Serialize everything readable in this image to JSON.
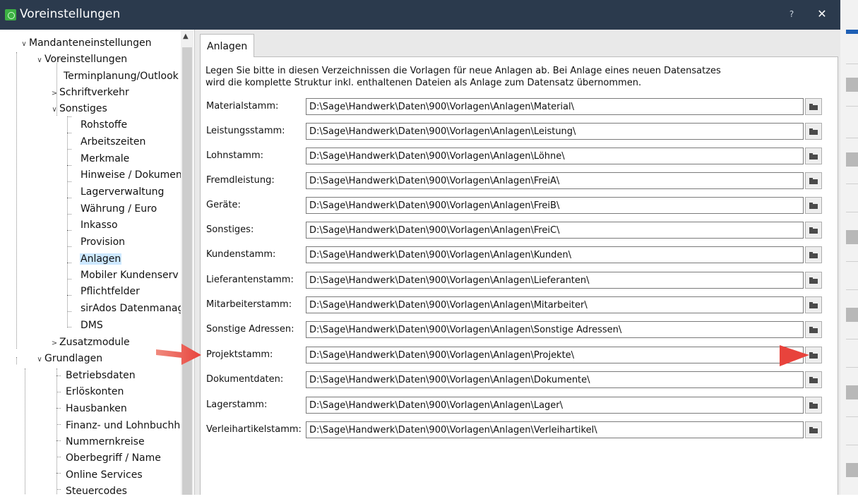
{
  "window": {
    "title": "Voreinstellungen",
    "help_label": "?",
    "close_label": "✕"
  },
  "tree": {
    "items": [
      {
        "label": "Mandanteneinstellungen",
        "expander": "∨"
      },
      {
        "label": "Voreinstellungen",
        "expander": "∨"
      },
      {
        "label": "Terminplanung/Outlook"
      },
      {
        "label": "Schriftverkehr",
        "expander": ">"
      },
      {
        "label": "Sonstiges",
        "expander": "∨"
      },
      {
        "label": "Rohstoffe"
      },
      {
        "label": "Arbeitszeiten"
      },
      {
        "label": "Merkmale"
      },
      {
        "label": "Hinweise / Dokumen"
      },
      {
        "label": "Lagerverwaltung"
      },
      {
        "label": "Währung / Euro"
      },
      {
        "label": "Inkasso"
      },
      {
        "label": "Provision"
      },
      {
        "label": "Anlagen",
        "selected": true
      },
      {
        "label": "Mobiler Kundenserv"
      },
      {
        "label": "Pflichtfelder"
      },
      {
        "label": "sirAdos Datenmanag"
      },
      {
        "label": "DMS"
      },
      {
        "label": "Zusatzmodule",
        "expander": ">"
      },
      {
        "label": "Grundlagen",
        "expander": "∨"
      },
      {
        "label": "Betriebsdaten"
      },
      {
        "label": "Erlöskonten"
      },
      {
        "label": "Hausbanken"
      },
      {
        "label": "Finanz- und Lohnbuchha"
      },
      {
        "label": "Nummernkreise"
      },
      {
        "label": "Oberbegriff / Name"
      },
      {
        "label": "Online Services"
      },
      {
        "label": "Steuercodes"
      }
    ]
  },
  "tab": {
    "label": "Anlagen"
  },
  "description": {
    "line1": "Legen Sie bitte in diesen Verzeichnissen die Vorlagen für neue Anlagen ab. Bei Anlage eines neuen Datensatzes",
    "line2": "wird die komplette Struktur inkl. enthaltenen Dateien als Anlage zum Datensatz übernommen."
  },
  "fields": [
    {
      "label": "Materialstamm:",
      "value": "D:\\Sage\\Handwerk\\Daten\\900\\Vorlagen\\Anlagen\\Material\\"
    },
    {
      "label": "Leistungsstamm:",
      "value": "D:\\Sage\\Handwerk\\Daten\\900\\Vorlagen\\Anlagen\\Leistung\\"
    },
    {
      "label": "Lohnstamm:",
      "value": "D:\\Sage\\Handwerk\\Daten\\900\\Vorlagen\\Anlagen\\Löhne\\"
    },
    {
      "label": "Fremdleistung:",
      "value": "D:\\Sage\\Handwerk\\Daten\\900\\Vorlagen\\Anlagen\\FreiA\\"
    },
    {
      "label": "Geräte:",
      "value": "D:\\Sage\\Handwerk\\Daten\\900\\Vorlagen\\Anlagen\\FreiB\\"
    },
    {
      "label": "Sonstiges:",
      "value": "D:\\Sage\\Handwerk\\Daten\\900\\Vorlagen\\Anlagen\\FreiC\\"
    },
    {
      "label": "Kundenstamm:",
      "value": "D:\\Sage\\Handwerk\\Daten\\900\\Vorlagen\\Anlagen\\Kunden\\"
    },
    {
      "label": "Lieferantenstamm:",
      "value": "D:\\Sage\\Handwerk\\Daten\\900\\Vorlagen\\Anlagen\\Lieferanten\\"
    },
    {
      "label": "Mitarbeiterstamm:",
      "value": "D:\\Sage\\Handwerk\\Daten\\900\\Vorlagen\\Anlagen\\Mitarbeiter\\"
    },
    {
      "label": "Sonstige Adressen:",
      "value": "D:\\Sage\\Handwerk\\Daten\\900\\Vorlagen\\Anlagen\\Sonstige Adressen\\"
    },
    {
      "label": "Projektstamm:",
      "value": "D:\\Sage\\Handwerk\\Daten\\900\\Vorlagen\\Anlagen\\Projekte\\"
    },
    {
      "label": "Dokumentdaten:",
      "value": "D:\\Sage\\Handwerk\\Daten\\900\\Vorlagen\\Anlagen\\Dokumente\\"
    },
    {
      "label": "Lagerstamm:",
      "value": "D:\\Sage\\Handwerk\\Daten\\900\\Vorlagen\\Anlagen\\Lager\\"
    },
    {
      "label": "Verleihartikelstamm:",
      "value": "D:\\Sage\\Handwerk\\Daten\\900\\Vorlagen\\Anlagen\\Verleihartikel\\"
    }
  ],
  "colors": {
    "titlebar": "#2b3a4d",
    "selection": "#cde8ff",
    "annotation_arrow": "#e8433c"
  },
  "icons": {
    "app": "sage-app-icon",
    "browse": "folder-icon"
  }
}
